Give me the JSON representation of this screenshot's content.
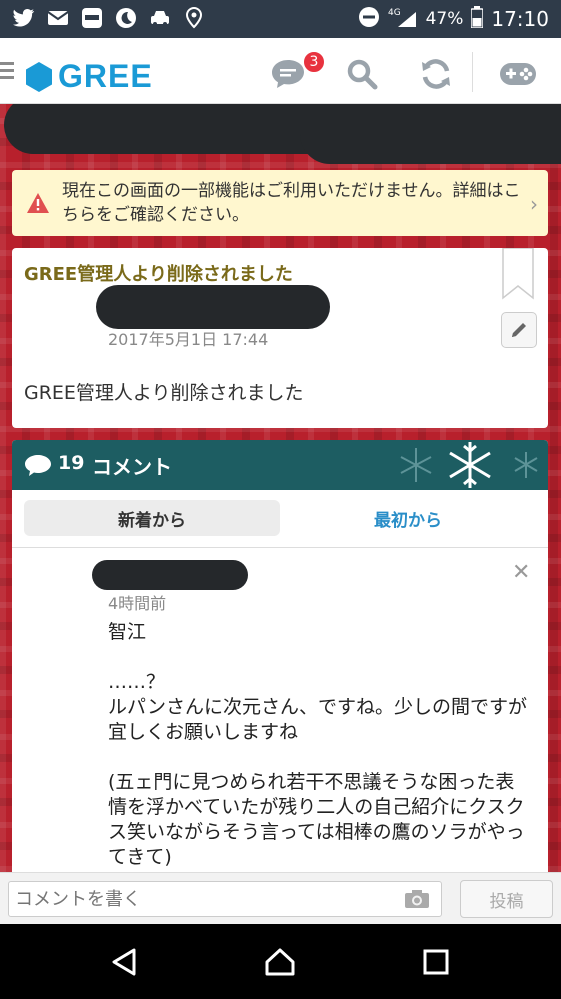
{
  "status_bar": {
    "battery": "47%",
    "network": "4G",
    "time": "17:10",
    "notification_icons": [
      "twitter-icon",
      "mail-icon",
      "app-icon",
      "moon-app-icon",
      "car-icon",
      "location-icon"
    ]
  },
  "app_header": {
    "logo_text": "GREE",
    "messages_badge": "3",
    "brand_color": "#1a9ad6"
  },
  "notice": {
    "text": "現在この画面の一部機能はご利用いただけません。詳細はこちらをご確認ください。"
  },
  "post": {
    "title": "GREE管理人より削除されました",
    "date": "2017年5月1日 17:44",
    "body": "GREE管理人より削除されました"
  },
  "comments": {
    "count": "19",
    "title": "コメント",
    "tabs": {
      "new": "新着から",
      "first": "最初から"
    },
    "items": [
      {
        "time": "4時間前",
        "paragraphs": [
          "智江",
          "……？\nルパンさんに次元さん、ですね。少しの間ですが宜しくお願いしますね",
          "(五ェ門に見つめられ若干不思議そうな困った表情を浮かべていたが残り二人の自己紹介にクスクス笑いながらそう言っては相棒の鷹のソラがやってきて)"
        ]
      }
    ]
  },
  "input": {
    "placeholder": "コメントを書く",
    "post_label": "投稿"
  }
}
